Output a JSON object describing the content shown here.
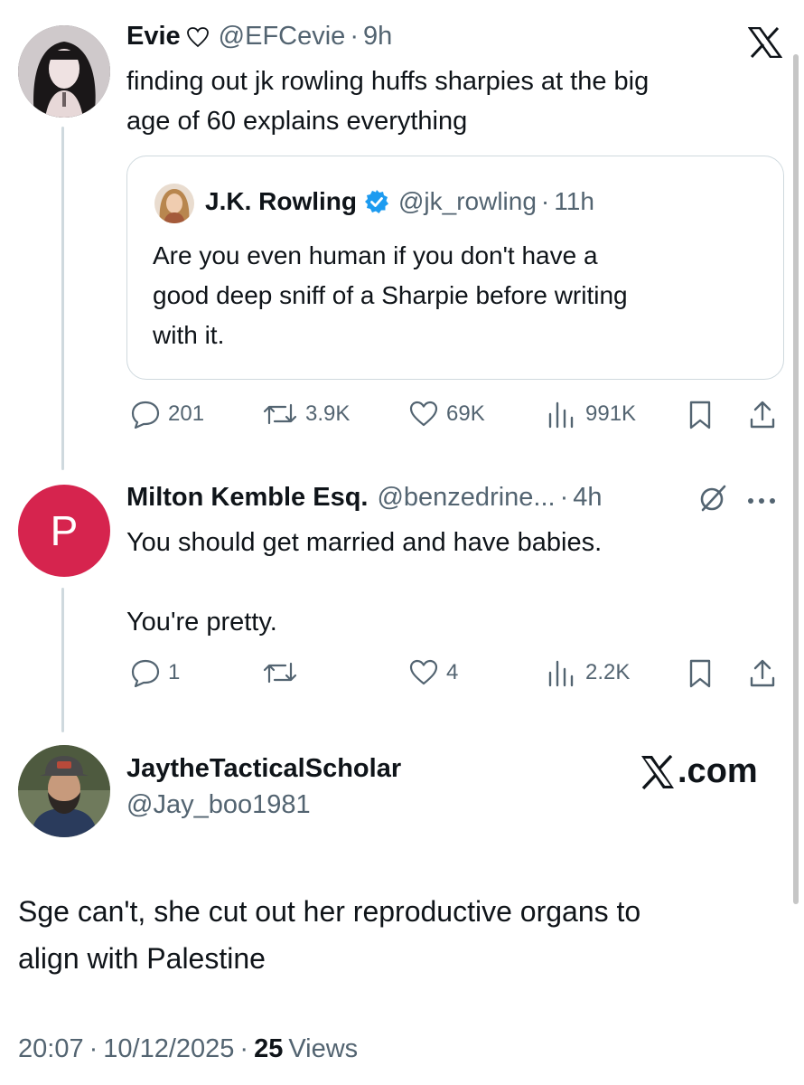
{
  "brand": {
    "logo_icon": "x-logo-icon",
    "watermark": "X.com"
  },
  "tweet_evie": {
    "name": "Evie",
    "heart_icon": "outline-heart-icon",
    "handle": "@EFCevie",
    "dot": "·",
    "time": "9h",
    "text_line1": "finding out jk rowling huffs sharpies at the big",
    "text_line2": "age of 60 explains everything",
    "quote": {
      "name": "J.K. Rowling",
      "verified_icon": "verified-badge-icon",
      "handle": "@jk_rowling",
      "dot": "·",
      "time": "11h",
      "text_line1": "Are you even human if you don't have a",
      "text_line2": "good deep sniff of a Sharpie before writing",
      "text_line3": "with it."
    },
    "stats": {
      "replies": "201",
      "reposts": "3.9K",
      "likes": "69K",
      "views": "991K"
    }
  },
  "tweet_milton": {
    "avatar_letter": "P",
    "avatar_color": "#d6244e",
    "name": "Milton Kemble Esq.",
    "handle": "@benzedrine...",
    "dot": "·",
    "time": "4h",
    "text_line1": "You should get married and have babies.",
    "text_line2": "You're pretty.",
    "stats": {
      "replies": "1",
      "reposts": "",
      "likes": "4",
      "views": "2.2K"
    }
  },
  "tweet_jay": {
    "name": "JaytheTacticalScholar",
    "handle": "@Jay_boo1981",
    "text_line1": "Sge can't, she cut out her reproductive organs to",
    "text_line2": "align with Palestine",
    "time": "20:07",
    "date": "10/12/2025",
    "dot": "·",
    "views_count": "25",
    "views_label": "Views"
  },
  "colors": {
    "text": "#0f1419",
    "secondary": "#536471",
    "border": "#cfd9de",
    "verified": "#1d9bf0"
  }
}
